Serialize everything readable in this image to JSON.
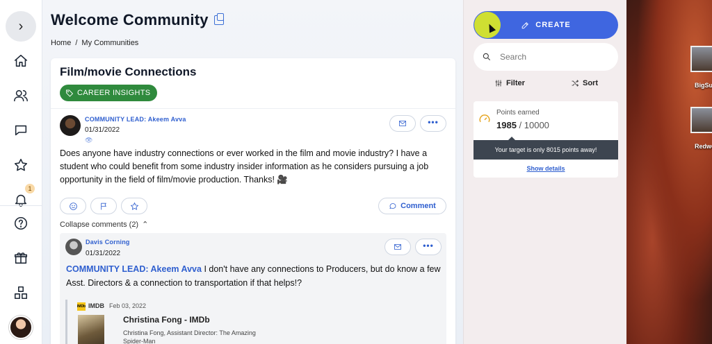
{
  "rail": {
    "expand_icon": "chevron-right-icon",
    "items": [
      "home-icon",
      "people-icon",
      "chat-icon",
      "star-icon",
      "bell-icon",
      "help-icon",
      "gift-icon",
      "apps-icon"
    ],
    "notification_count": "1"
  },
  "header": {
    "title": "Welcome Community",
    "breadcrumb": [
      "Home",
      "/",
      "My Communities"
    ]
  },
  "post": {
    "title": "Film/movie Connections",
    "tag": "CAREER INSIGHTS",
    "author": "COMMUNITY LEAD: Akeem Avva",
    "date": "01/31/2022",
    "body": "Does anyone have industry connections or ever worked in the film and movie industry? I have a student who could benefit from some industry insider information as he considers pursuing a job opportunity in the field of film/movie production. Thanks! 🎥",
    "comment_label": "Comment",
    "collapse_label": "Collapse comments (2)",
    "more_label": "•••"
  },
  "reply": {
    "author": "Davis Corning",
    "date": "01/31/2022",
    "mention": "COMMUNITY LEAD: Akeem Avva",
    "body": "I don't have any connections to Producers, but do know a few Asst. Directors & a connection to transportation if that helps!?",
    "more_label": "•••",
    "preview": {
      "logo": "IMDb",
      "site": "IMDB",
      "date": "Feb 03, 2022",
      "title": "Christina Fong - IMDb",
      "description": "Christina Fong, Assistant Director: The Amazing Spider-Man"
    }
  },
  "sidebar": {
    "create_label": "CREATE",
    "search_placeholder": "Search",
    "filter_label": "Filter",
    "sort_label": "Sort",
    "points": {
      "label": "Points earned",
      "earned": "1985",
      "separator": " / ",
      "max": "10000",
      "tip": "Your target is only 8015 points away!",
      "details_link": "Show details"
    }
  },
  "desktop": {
    "icons": [
      {
        "label": "BigSu"
      },
      {
        "label": "Redwo"
      }
    ]
  },
  "colors": {
    "accent": "#3f66e0",
    "tag_green": "#2f8a3d",
    "link_blue": "#2f5fcf"
  }
}
